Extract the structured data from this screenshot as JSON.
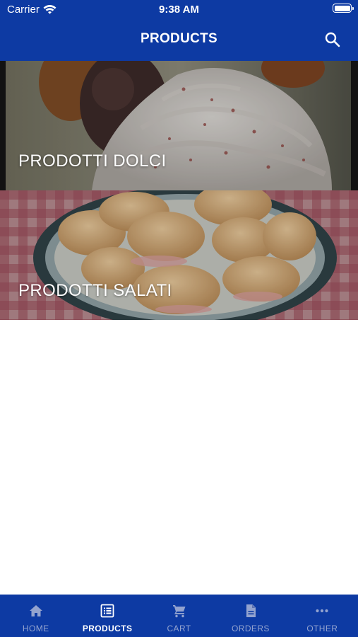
{
  "status_bar": {
    "carrier": "Carrier",
    "time": "9:38 AM"
  },
  "header": {
    "title": "PRODUCTS",
    "search_icon": "search-icon",
    "background": "#0d3aa3"
  },
  "categories": [
    {
      "label": "PRODOTTI DOLCI",
      "image": "cupcake-with-whipped-cream-photo"
    },
    {
      "label": "PRODOTTI SALATI",
      "image": "filled-croissants-plate-photo"
    }
  ],
  "tabbar": {
    "background": "#0d3aa3",
    "active_color": "#ffffff",
    "inactive_color": "#93a3cf",
    "items": [
      {
        "label": "HOME",
        "icon": "home-icon",
        "active": false
      },
      {
        "label": "PRODUCTS",
        "icon": "list-icon",
        "active": true
      },
      {
        "label": "CART",
        "icon": "cart-icon",
        "active": false
      },
      {
        "label": "ORDERS",
        "icon": "document-icon",
        "active": false
      },
      {
        "label": "OTHER",
        "icon": "more-icon",
        "active": false
      }
    ]
  }
}
